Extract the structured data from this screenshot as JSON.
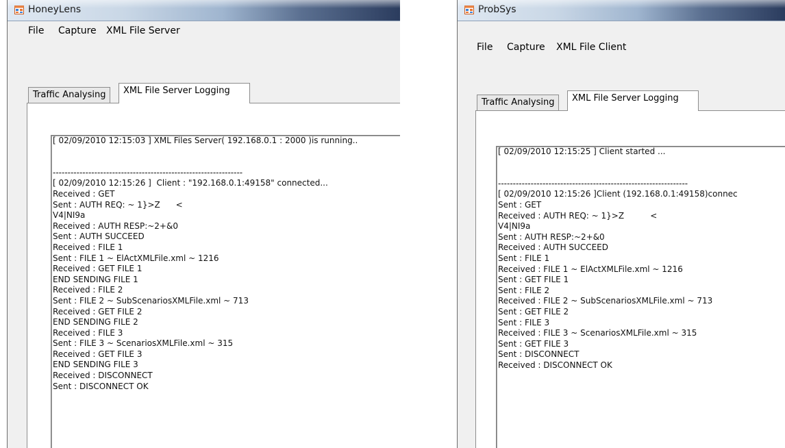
{
  "left": {
    "title": "HoneyLens",
    "menu": [
      "File",
      "Capture",
      "XML File Server"
    ],
    "tabs": [
      "Traffic Analysing",
      "XML File Server Logging"
    ],
    "log": [
      "[ 02/09/2010 12:15:03 ] XML Files Server( 192.168.0.1 : 2000 )is running..",
      "",
      "",
      "----------------------------------------------------------------",
      "[ 02/09/2010 12:15:26 ]  Client : \"192.168.0.1:49158\" connected...",
      "Received : GET",
      "Sent : AUTH REQ: ~ 1}>Z      <",
      "V4|NI9a",
      "Received : AUTH RESP:~2+&0",
      "Sent : AUTH SUCCEED",
      "Received : FILE 1",
      "Sent : FILE 1 ~ ElActXMLFile.xml ~ 1216",
      "Received : GET FILE 1",
      "END SENDING FILE 1",
      "Received : FILE 2",
      "Sent : FILE 2 ~ SubScenariosXMLFile.xml ~ 713",
      "Received : GET FILE 2",
      "END SENDING FILE 2",
      "Received : FILE 3",
      "Sent : FILE 3 ~ ScenariosXMLFile.xml ~ 315",
      "Received : GET FILE 3",
      "END SENDING FILE 3",
      "Received : DISCONNECT",
      "Sent : DISCONNECT OK"
    ]
  },
  "right": {
    "title": "ProbSys",
    "menu": [
      "File",
      "Capture",
      "XML File Client"
    ],
    "tabs": [
      "Traffic Analysing",
      "XML File Server Logging"
    ],
    "log": [
      "[ 02/09/2010 12:15:25 ] Client started ...",
      "",
      "",
      "----------------------------------------------------------------",
      "[ 02/09/2010 12:15:26 ]Client (192.168.0.1:49158)connec",
      "Sent : GET",
      "Received : AUTH REQ: ~ 1}>Z          <",
      "V4|NI9a",
      "Sent : AUTH RESP:~2+&0",
      "Received : AUTH SUCCEED",
      "Sent : FILE 1",
      "Received : FILE 1 ~ ElActXMLFile.xml ~ 1216",
      "Sent : GET FILE 1",
      "Sent : FILE 2",
      "Received : FILE 2 ~ SubScenariosXMLFile.xml ~ 713",
      "Sent : GET FILE 2",
      "Sent : FILE 3",
      "Received : FILE 3 ~ ScenariosXMLFile.xml ~ 315",
      "Sent : GET FILE 3",
      "Sent : DISCONNECT",
      "Received : DISCONNECT OK"
    ]
  }
}
